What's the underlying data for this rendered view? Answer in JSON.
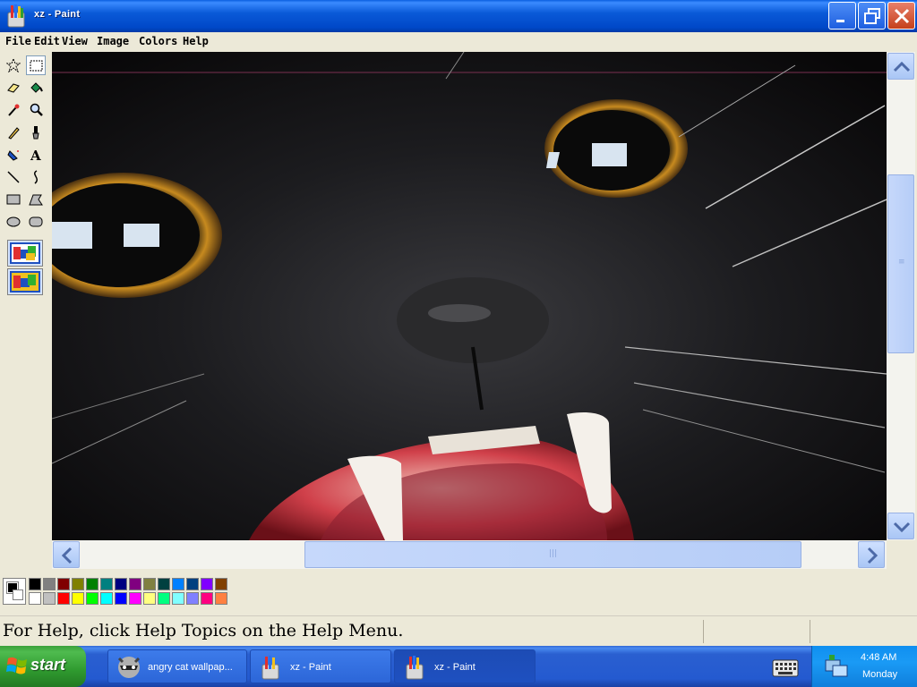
{
  "window": {
    "title": "xz - Paint"
  },
  "menu": [
    "File",
    "Edit",
    "View",
    "Image",
    "Colors",
    "Help"
  ],
  "tools": [
    "free-form-select",
    "select",
    "eraser",
    "fill",
    "pick-color",
    "magnifier",
    "pencil",
    "brush",
    "airbrush",
    "text",
    "line",
    "curve",
    "rectangle",
    "polygon",
    "ellipse",
    "rounded-rectangle"
  ],
  "palette": {
    "top": [
      "#000000",
      "#808080",
      "#800000",
      "#808000",
      "#008000",
      "#008080",
      "#000080",
      "#800080",
      "#808040",
      "#004040",
      "#0080ff",
      "#004080",
      "#8000ff",
      "#804000"
    ],
    "bottom": [
      "#ffffff",
      "#c0c0c0",
      "#ff0000",
      "#ffff00",
      "#00ff00",
      "#00ffff",
      "#0000ff",
      "#ff00ff",
      "#ffff80",
      "#00ff80",
      "#80ffff",
      "#8080ff",
      "#ff0080",
      "#ff8040"
    ]
  },
  "status": {
    "text": "For Help, click Help Topics on the Help Menu."
  },
  "taskbar": {
    "start_label": "start",
    "tasks": [
      {
        "label": "angry cat wallpap...",
        "icon": "raccoon-icon"
      },
      {
        "label": "xz - Paint",
        "icon": "paint-icon"
      },
      {
        "label": "xz - Paint",
        "icon": "paint-icon"
      }
    ],
    "clock_time": "4:48 AM",
    "clock_day": "Monday"
  }
}
